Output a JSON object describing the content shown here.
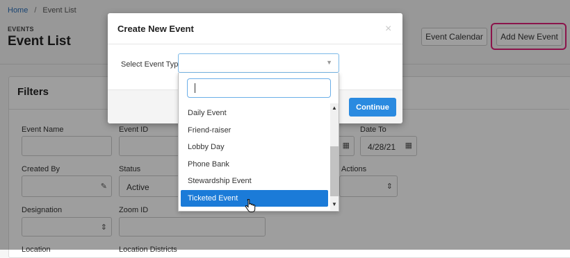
{
  "breadcrumb": {
    "home": "Home",
    "separator": "/",
    "current": "Event List"
  },
  "header": {
    "kicker": "EVENTS",
    "title": "Event List",
    "calendar_button": "Event Calendar",
    "add_button": "Add New Event"
  },
  "filters": {
    "title": "Filters",
    "fields": {
      "event_name": "Event Name",
      "event_id": "Event ID",
      "date_to": "Date To",
      "date_from_value": "",
      "date_to_value": "4/28/21",
      "created_by": "Created By",
      "status": "Status",
      "status_value": "Active",
      "actions": "Actions",
      "designation": "Designation",
      "zoom_id": "Zoom ID",
      "location": "Location",
      "location_districts": "Location Districts"
    }
  },
  "modal": {
    "title": "Create New Event",
    "close": "×",
    "select_label": "Select Event Type",
    "continue_button": "Continue"
  },
  "dropdown": {
    "search_placeholder": "",
    "options": [
      "Daily Event",
      "Friend-raiser",
      "Lobby Day",
      "Phone Bank",
      "Stewardship Event",
      "Ticketed Event"
    ],
    "highlighted": "Ticketed Event"
  },
  "colors": {
    "accent": "#1b7bd8",
    "highlight_outline": "#e0217a",
    "continue": "#2a8ae0"
  }
}
